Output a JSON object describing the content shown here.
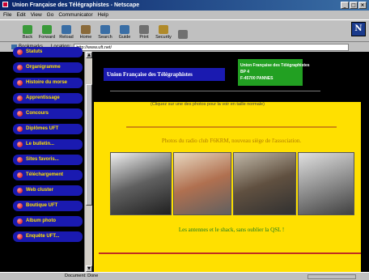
{
  "window": {
    "title": "Union Française des Télégraphistes - Netscape"
  },
  "menu": [
    "File",
    "Edit",
    "View",
    "Go",
    "Communicator",
    "Help"
  ],
  "toolbar": [
    {
      "label": "Back",
      "icon": "back-arrow-icon",
      "color": "#3a9a3a"
    },
    {
      "label": "Forward",
      "icon": "forward-arrow-icon",
      "color": "#3a9a3a"
    },
    {
      "label": "Reload",
      "icon": "reload-icon",
      "color": "#3a6ea5"
    },
    {
      "label": "Home",
      "icon": "home-icon",
      "color": "#8a6a3a"
    },
    {
      "label": "Search",
      "icon": "search-icon",
      "color": "#3a6ea5"
    },
    {
      "label": "Guide",
      "icon": "guide-icon",
      "color": "#3a6ea5"
    },
    {
      "label": "Print",
      "icon": "print-icon",
      "color": "#707070"
    },
    {
      "label": "Security",
      "icon": "lock-icon",
      "color": "#b08a2a"
    },
    {
      "label": "",
      "icon": "stop-icon",
      "color": "#707070"
    }
  ],
  "location": {
    "bookmarks_label": "Bookmarks",
    "location_label": "Location:",
    "url": "http://www.uft.net/"
  },
  "sidebar": {
    "items": [
      {
        "label": "Statuts"
      },
      {
        "label": "Organigramme"
      },
      {
        "label": "Histoire du morse"
      },
      {
        "label": "Apprentissage"
      },
      {
        "label": "Concours"
      },
      {
        "label": "Diplômes UFT"
      },
      {
        "label": "Le bulletin..."
      },
      {
        "label": "Sites favoris..."
      },
      {
        "label": "Téléchargement"
      },
      {
        "label": "Web cluster"
      },
      {
        "label": "Boutique UFT"
      },
      {
        "label": "Album photo"
      },
      {
        "label": "Enquête UFT..."
      }
    ]
  },
  "banner": {
    "title": "Union Française des Télégraphistes",
    "address": [
      "Union Française des Télégraphistes",
      "BP 4",
      "F-45700 PANNES"
    ]
  },
  "main": {
    "top_caption": "(Cliquez sur une des photos pour la voir en taille normale)",
    "caption_top": "Photos du radio club F6KRM, nouveau siège de l'association.",
    "caption_bottom": "Les antennes et le shack, sans oublier la QSL !",
    "photos": [
      {
        "name": "antenna-photo",
        "colors": [
          "#f0f0f0",
          "#606060",
          "#202020"
        ]
      },
      {
        "name": "qsl-card-photo",
        "colors": [
          "#e8d8c0",
          "#b07050",
          "#606060"
        ]
      },
      {
        "name": "shack-photo-1",
        "colors": [
          "#c0b8a8",
          "#605040",
          "#303030"
        ]
      },
      {
        "name": "shack-photo-2",
        "colors": [
          "#e0e0e0",
          "#909090",
          "#404040"
        ]
      }
    ]
  },
  "status": {
    "text": "Document: Done"
  }
}
